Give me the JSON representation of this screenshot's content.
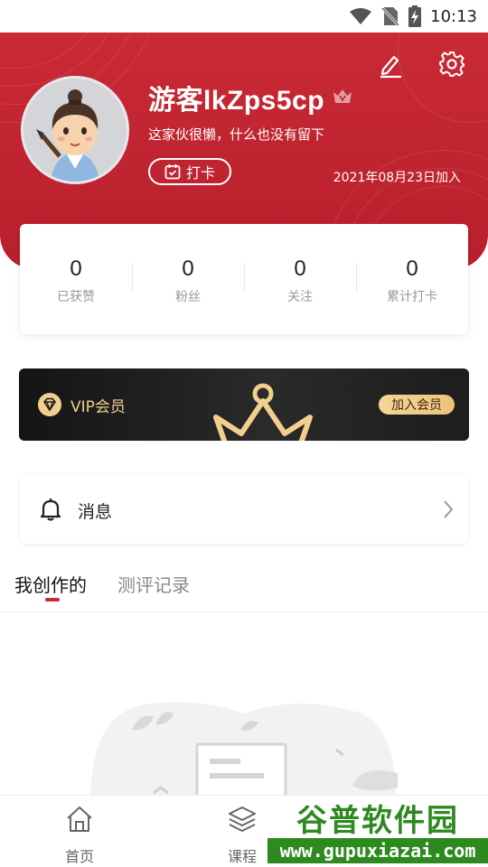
{
  "status_bar": {
    "time": "10:13"
  },
  "profile": {
    "username": "游客lkZps5cp",
    "bio": "这家伙很懒，什么也没有留下",
    "checkin_label": "打卡",
    "join_date": "2021年08月23日加入"
  },
  "stats": [
    {
      "value": "0",
      "label": "已获赞"
    },
    {
      "value": "0",
      "label": "粉丝"
    },
    {
      "value": "0",
      "label": "关注"
    },
    {
      "value": "0",
      "label": "累计打卡"
    }
  ],
  "vip": {
    "title": "VIP会员",
    "join_label": "加入会员"
  },
  "message": {
    "label": "消息"
  },
  "tabs": [
    {
      "label": "我创作的",
      "active": true
    },
    {
      "label": "测评记录",
      "active": false
    }
  ],
  "nav": [
    {
      "label": "首页",
      "icon": "home-icon"
    },
    {
      "label": "课程",
      "icon": "layers-icon"
    }
  ],
  "watermark": {
    "title": "谷普软件园",
    "url": "www.gupuxiazai.com"
  },
  "colors": {
    "brand": "#c62a35",
    "vip_gold": "#f3cf8e",
    "watermark_green": "#2e8a1f"
  }
}
